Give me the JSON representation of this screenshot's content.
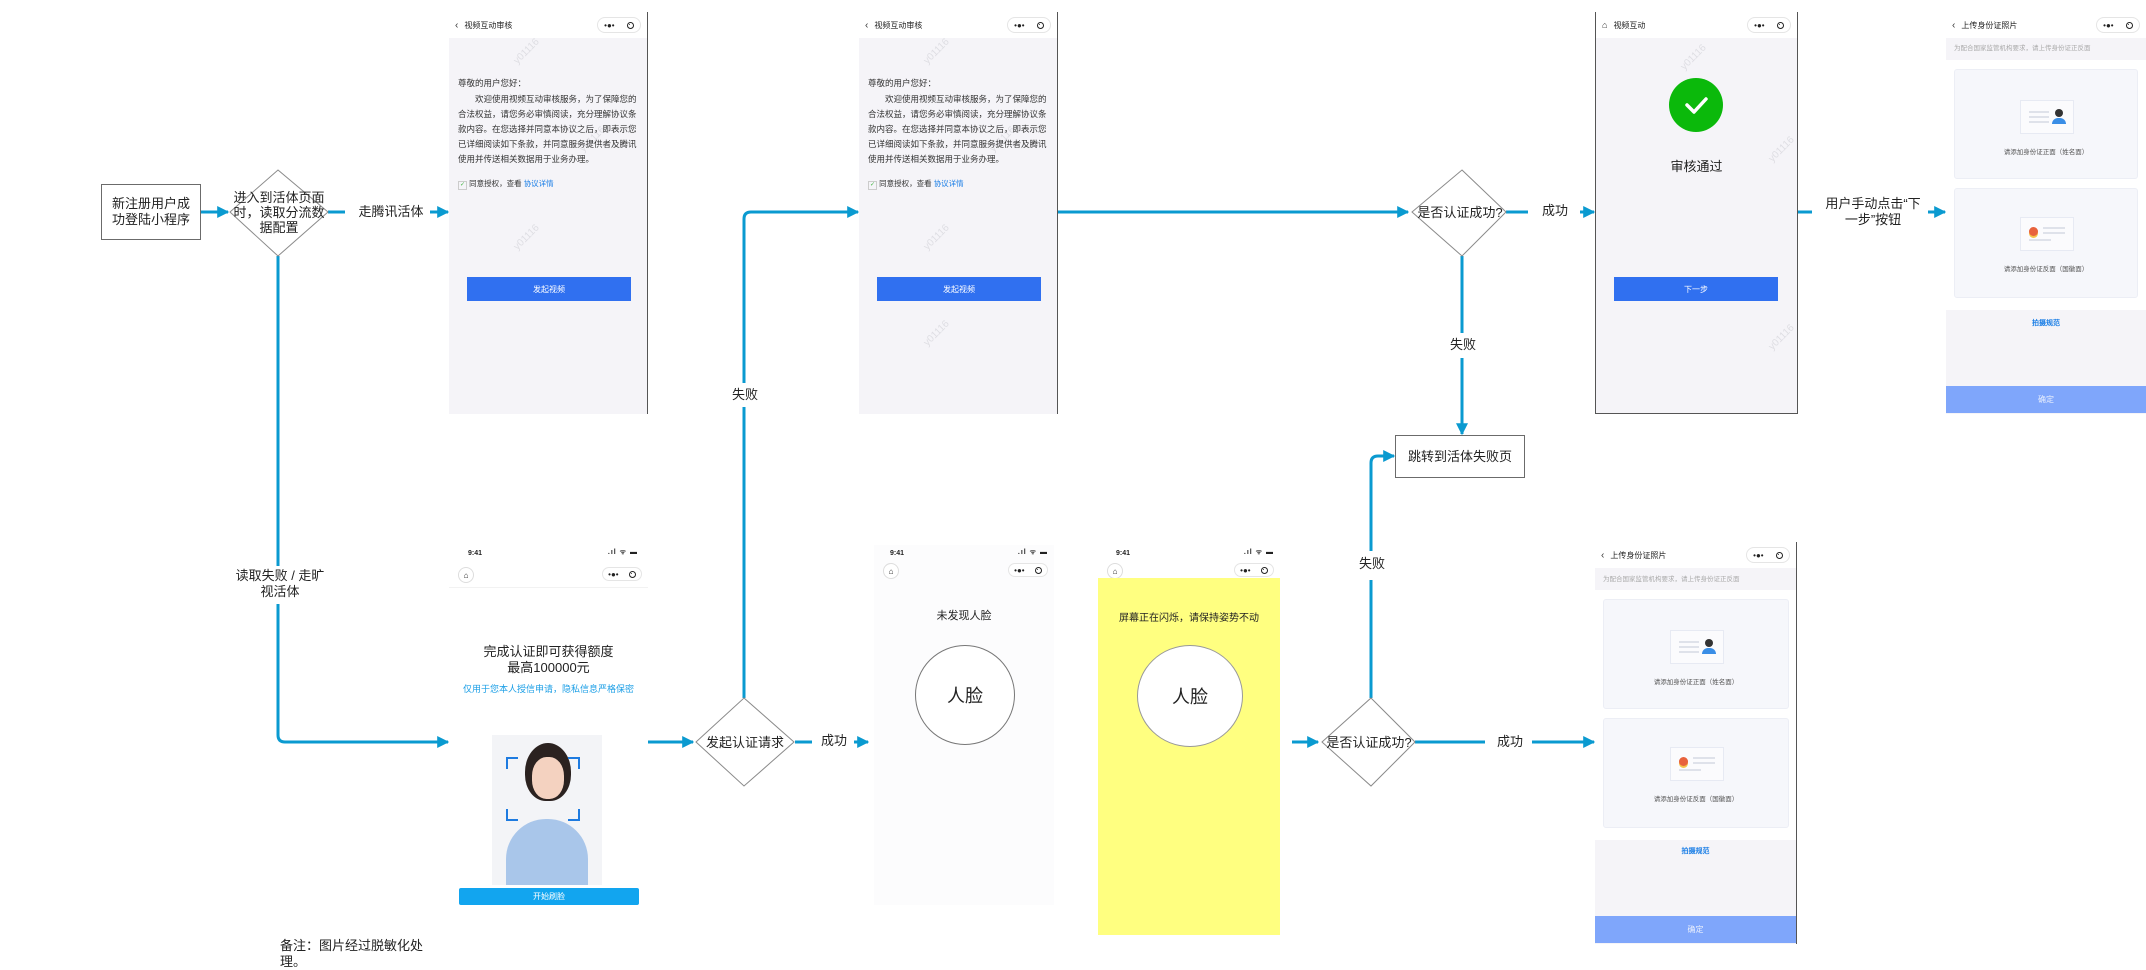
{
  "diagram": {
    "nodes": {
      "start": "新注册用户成功登陆小程序",
      "read_config": "进入到活体页面时，读取分流数据配置",
      "auth_success_1": "是否认证成功?",
      "send_auth": "发起认证请求",
      "auth_success_2": "是否认证成功?",
      "fail_page": "跳转到活体失败页"
    },
    "edge_labels": {
      "tencent": "走腾讯活体",
      "read_fail": "读取失败 / 走旷视活体",
      "fail_1": "失败",
      "success_1": "成功",
      "fail_2": "失败",
      "success_2": "成功",
      "fail_3": "失败",
      "success_3": "成功",
      "next_click": "用户手动点击“下一步”按钮"
    },
    "note": "备注：图片经过脱敏化处理。"
  },
  "screens": {
    "agreement": {
      "title": "视频互动审核",
      "greeting": "尊敬的用户您好：",
      "body": "欢迎使用视频互动审核服务，为了保障您的合法权益，请您务必审慎阅读，充分理解协议条款内容。在您选择并同意本协议之后，即表示您已详细阅读如下条款，并同意服务提供者及腾讯使用并传送相关数据用于业务办理。",
      "agree_prefix": "同意授权，查看",
      "agree_link": "协议详情",
      "button": "发起视频",
      "watermark": "y01116"
    },
    "approved": {
      "title": "视频互动",
      "status": "审核通过",
      "button": "下一步",
      "watermark": "y01116"
    },
    "upload_id": {
      "title": "上传身份证照片",
      "notice": "为配合国家监管机构要求，请上传身份证正反面",
      "front_caption": "请添加身份证正面（姓名面）",
      "back_caption": "请添加身份证反面（国徽面）",
      "guide_link": "拍摄规范",
      "button": "确定"
    },
    "megvii_start": {
      "time": "9:41",
      "headline_1": "完成认证即可获得额度",
      "headline_2": "最高100000元",
      "privacy": "仅用于您本人授信申请，隐私信息严格保密",
      "button": "开始刷脸"
    },
    "no_face": {
      "time": "9:41",
      "message": "未发现人脸",
      "circle_label": "人脸"
    },
    "flashing": {
      "time": "9:41",
      "message": "屏幕正在闪烁，请保持姿势不动",
      "circle_label": "人脸"
    }
  },
  "colors": {
    "connector": "#0a9ad0",
    "primary_button": "#3070f0",
    "success_green": "#0bb90b",
    "flash_yellow": "#ffff80",
    "link_blue": "#1a7ee6",
    "confirm_button": "#7fa6fb"
  }
}
